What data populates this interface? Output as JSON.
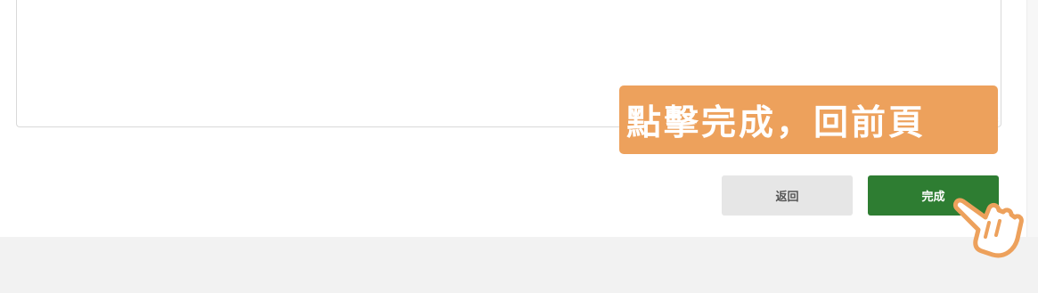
{
  "form": {
    "textarea_value": ""
  },
  "actions": {
    "back_label": "返回",
    "done_label": "完成"
  },
  "callout": {
    "text": "點擊完成，回前頁"
  },
  "icons": {
    "pointer": "pointing-hand-icon",
    "resize": "resize-handle-icon"
  },
  "colors": {
    "done_button": "#2e7d32",
    "back_button": "#e6e6e6",
    "callout_bg": "#eda15c",
    "page_bg": "#f2f2f2"
  }
}
